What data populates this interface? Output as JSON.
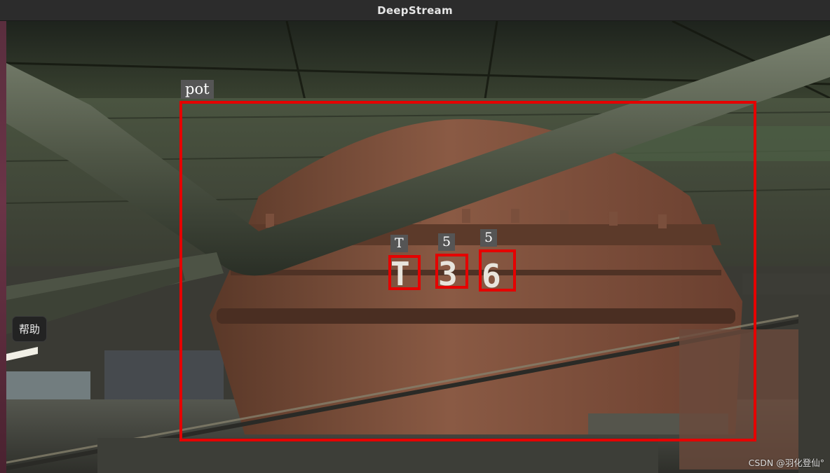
{
  "window": {
    "title": "DeepStream"
  },
  "detections": [
    {
      "label": "pot",
      "color": "#e50000"
    },
    {
      "label": "T",
      "color": "#e50000"
    },
    {
      "label": "5",
      "color": "#e50000"
    },
    {
      "label": "5",
      "color": "#e50000"
    }
  ],
  "scene": {
    "painted_characters": [
      "T",
      "3",
      "6"
    ]
  },
  "help_button": {
    "label": "帮助"
  },
  "watermark": {
    "text": "CSDN @羽化登仙°"
  }
}
